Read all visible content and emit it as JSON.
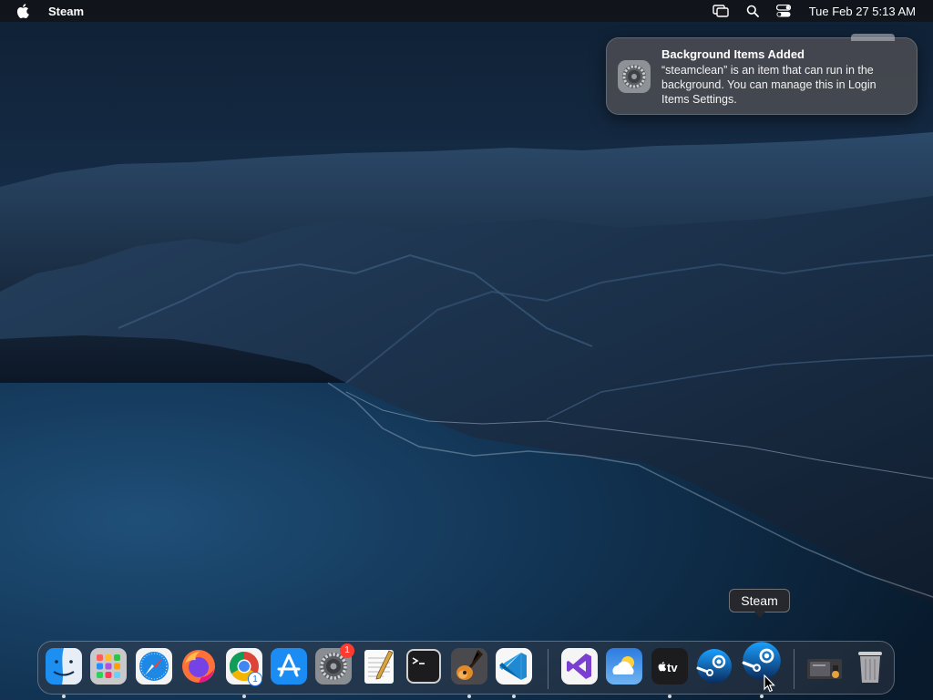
{
  "menubar": {
    "app_name": "Steam",
    "clock": "Tue Feb 27  5:13 AM",
    "icons": [
      "apple-icon",
      "screen-mirroring-icon",
      "spotlight-search-icon",
      "control-center-icon"
    ]
  },
  "notification": {
    "title": "Background Items Added",
    "body": "“steamclean” is an item that can run in the background. You can manage this in Login Items Settings.",
    "icon": "system-settings-gear-icon"
  },
  "tooltip": {
    "label": "Steam"
  },
  "dock": {
    "items": [
      {
        "name": "Finder",
        "icon": "finder-icon",
        "running": true
      },
      {
        "name": "Launchpad",
        "icon": "launchpad-icon",
        "running": false
      },
      {
        "name": "Safari",
        "icon": "safari-icon",
        "running": false
      },
      {
        "name": "Firefox",
        "icon": "firefox-icon",
        "running": false
      },
      {
        "name": "Google Chrome",
        "icon": "chrome-icon",
        "running": true,
        "badge": "1"
      },
      {
        "name": "App Store",
        "icon": "app-store-icon",
        "running": false
      },
      {
        "name": "System Settings",
        "icon": "system-settings-icon",
        "running": false,
        "badge": "1"
      },
      {
        "name": "TextEdit",
        "icon": "textedit-icon",
        "running": false
      },
      {
        "name": "Terminal",
        "icon": "terminal-icon",
        "running": false
      },
      {
        "name": "GarageBand",
        "icon": "garageband-icon",
        "running": true
      },
      {
        "name": "Visual Studio Code",
        "icon": "vscode-icon",
        "running": true
      },
      {
        "name": "Visual Studio",
        "icon": "visual-studio-icon",
        "running": false
      },
      {
        "name": "Weather",
        "icon": "weather-icon",
        "running": false
      },
      {
        "name": "Apple TV",
        "icon": "apple-tv-icon",
        "running": true,
        "label": "tv"
      },
      {
        "name": "Steam",
        "icon": "steam-icon",
        "running": false
      },
      {
        "name": "Steam",
        "icon": "steam-icon",
        "running": true
      },
      {
        "name": "Downloads",
        "icon": "downloads-stack-icon",
        "running": false
      },
      {
        "name": "Trash",
        "icon": "trash-icon",
        "running": false
      }
    ]
  },
  "colors": {
    "menubar_bg": "#141416",
    "notification_bg": "#484a50",
    "badge_red": "#ff3b30",
    "wallpaper_sky": "#1b3555",
    "wallpaper_sea": "#143252"
  }
}
